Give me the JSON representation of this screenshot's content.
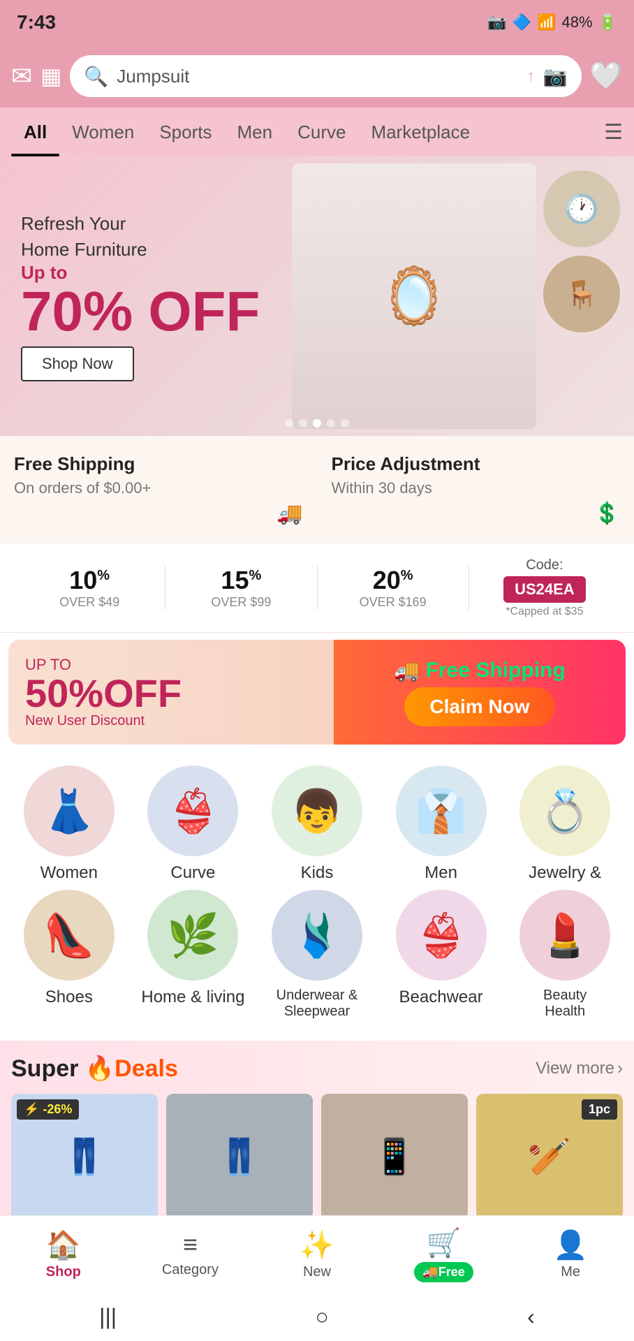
{
  "statusBar": {
    "time": "7:43",
    "battery": "48%"
  },
  "header": {
    "searchPlaceholder": "Jumpsuit",
    "mailIcon": "✉",
    "calendarIcon": "▦",
    "searchIconLabel": "search-icon",
    "cameraIconLabel": "camera-icon",
    "heartIconLabel": "wishlist-icon",
    "arrowUp": "↑"
  },
  "navTabs": {
    "tabs": [
      {
        "id": "all",
        "label": "All",
        "active": true
      },
      {
        "id": "women",
        "label": "Women",
        "active": false
      },
      {
        "id": "sports",
        "label": "Sports",
        "active": false
      },
      {
        "id": "men",
        "label": "Men",
        "active": false
      },
      {
        "id": "curve",
        "label": "Curve",
        "active": false
      },
      {
        "id": "marketplace",
        "label": "Marketplace",
        "active": false
      }
    ]
  },
  "banner": {
    "subtitle": "Refresh Your\nHome Furniture",
    "upTo": "Up to",
    "discount": "70% OFF",
    "shopBtn": "Shop Now",
    "dots": [
      false,
      false,
      true,
      false,
      false
    ]
  },
  "infoCards": [
    {
      "title": "Free Shipping",
      "sub": "On orders of $0.00+",
      "icon": "🚚"
    },
    {
      "title": "Price Adjustment",
      "sub": "Within 30 days",
      "icon": "💲"
    }
  ],
  "discountRow": [
    {
      "pct": "10",
      "sup": "%",
      "label": "OVER $49"
    },
    {
      "pct": "15",
      "sup": "%",
      "label": "OVER $99"
    },
    {
      "pct": "20",
      "sup": "%",
      "label": "OVER $169"
    },
    {
      "code": "US24EA",
      "label": "*Capped at $35",
      "prefix": "Code:"
    }
  ],
  "newUserBanner": {
    "upTo": "UP TO",
    "discount": "50%OFF",
    "label": "New User Discount",
    "freeShipping": "Free Shipping",
    "claimBtn": "Claim Now",
    "truckIcon": "🚚"
  },
  "categories": {
    "row1": [
      {
        "id": "women",
        "label": "Women",
        "emoji": "👗"
      },
      {
        "id": "curve",
        "label": "Curve",
        "emoji": "👙"
      },
      {
        "id": "kids",
        "label": "Kids",
        "emoji": "👶"
      },
      {
        "id": "men",
        "label": "Men",
        "emoji": "👔"
      },
      {
        "id": "jewelry",
        "label": "Jewelry &",
        "emoji": "💍"
      }
    ],
    "row2": [
      {
        "id": "shoes",
        "label": "Shoes",
        "emoji": "👠"
      },
      {
        "id": "home",
        "label": "Home & living",
        "emoji": "🌿"
      },
      {
        "id": "underwear",
        "label": "Underwear &\nSleepwear",
        "emoji": "👙"
      },
      {
        "id": "beachwear",
        "label": "Beachwear",
        "emoji": "👙"
      },
      {
        "id": "beauty",
        "label": "Beauty\nHealth",
        "emoji": "💄"
      }
    ]
  },
  "superDeals": {
    "logo": "Super",
    "logoAccent": "🔥Deals",
    "viewMore": "View more",
    "deals": [
      {
        "id": 1,
        "badge": "⚡ -26%",
        "emoji": "👖",
        "bg": "#c8d8e8"
      },
      {
        "id": 2,
        "badge": "",
        "emoji": "👖",
        "bg": "#b0b8c0"
      },
      {
        "id": 3,
        "badge": "",
        "emoji": "📱",
        "bg": "#c0b8b0"
      },
      {
        "id": 4,
        "badge1pc": "1pc",
        "emoji": "🏏",
        "bg": "#d8c890"
      }
    ]
  },
  "bottomNav": {
    "items": [
      {
        "id": "shop",
        "label": "Shop",
        "icon": "🏠",
        "active": true
      },
      {
        "id": "category",
        "label": "Category",
        "icon": "≡",
        "active": false
      },
      {
        "id": "new",
        "label": "New",
        "icon": "✨",
        "active": false
      },
      {
        "id": "free",
        "label": "Free",
        "icon": "🛒",
        "active": false,
        "badge": "🚚Free"
      },
      {
        "id": "me",
        "label": "Me",
        "icon": "👤",
        "active": false
      }
    ]
  },
  "sysNav": {
    "menu": "|||",
    "home": "○",
    "back": "<"
  }
}
